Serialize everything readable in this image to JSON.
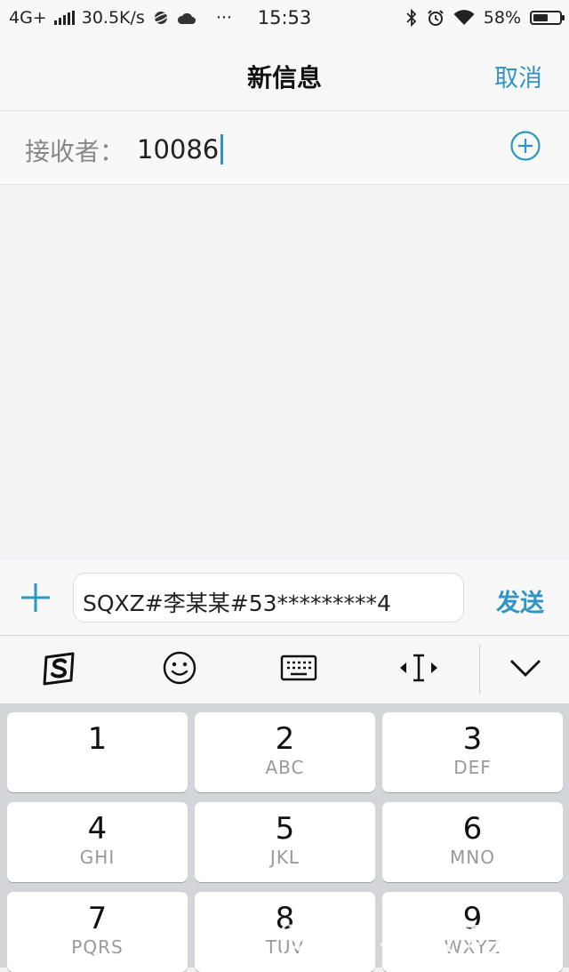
{
  "status_bar": {
    "network": "4G+",
    "speed": "30.5K/s",
    "more": "···",
    "time": "15:53",
    "battery_percent": "58%",
    "battery_level": 0.58
  },
  "header": {
    "title": "新信息",
    "cancel_label": "取消"
  },
  "recipient": {
    "label": "接收者：",
    "value": "10086"
  },
  "compose": {
    "message": "SQXZ#李某某#53*********4",
    "send_label": "发送"
  },
  "keyboard": {
    "toolbar_icons": [
      "sogou-logo-icon",
      "emoji-icon",
      "keyboard-icon",
      "cursor-move-icon",
      "chevron-down-icon"
    ],
    "keys": [
      {
        "num": "1",
        "letters": ""
      },
      {
        "num": "2",
        "letters": "ABC"
      },
      {
        "num": "3",
        "letters": "DEF"
      },
      {
        "num": "4",
        "letters": "GHI"
      },
      {
        "num": "5",
        "letters": "JKL"
      },
      {
        "num": "6",
        "letters": "MNO"
      },
      {
        "num": "7",
        "letters": "PQRS"
      },
      {
        "num": "8",
        "letters": "TUV"
      },
      {
        "num": "9",
        "letters": "WXYZ"
      }
    ]
  },
  "watermark": "快传号/小技巧",
  "colors": {
    "accent": "#2f95c5",
    "background": "#f2f2f4",
    "keypad_bg": "#d3d5d9"
  }
}
